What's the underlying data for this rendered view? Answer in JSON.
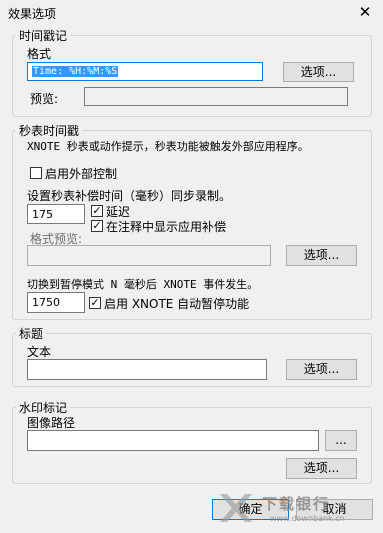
{
  "window": {
    "title": "效果选项",
    "close_glyph": "✕"
  },
  "timestamp": {
    "legend": "时间戳记",
    "format_label": "格式",
    "format_value": "Time: %H:%M:%S",
    "options_button": "选项...",
    "preview_label": "预览:",
    "preview_value": ""
  },
  "stopwatch": {
    "legend": "秒表时间戳",
    "description": "XNOTE 秒表或动作提示，秒表功能被触发外部应用程序。",
    "external_control_label": "启用外部控制",
    "external_control_checked": false,
    "comp_desc": "设置秒表补偿时间（毫秒）同步录制。",
    "comp_value": "175",
    "delay_label": "延迟",
    "delay_checked": true,
    "show_comp_label": "在注释中显示应用补偿",
    "show_comp_checked": true,
    "format_preview_label": "格式预览:",
    "format_preview_value": "",
    "options_button": "选项...",
    "pause_desc": "切换到暂停模式 N 毫秒后 XNOTE 事件发生。",
    "pause_value": "1750",
    "auto_pause_label": "启用 XNOTE 自动暂停功能",
    "auto_pause_checked": true
  },
  "heading": {
    "legend": "标题",
    "text_label": "文本",
    "text_value": "",
    "options_button": "选项..."
  },
  "watermark": {
    "legend": "水印标记",
    "image_path_label": "图像路径",
    "image_path_value": "",
    "browse_button": "...",
    "options_button": "选项..."
  },
  "footer": {
    "ok_button": "确定",
    "cancel_button": "取消"
  },
  "site_watermark": {
    "text": "下载银行",
    "url": "www.downbank.cn"
  },
  "check_glyph": "✓"
}
